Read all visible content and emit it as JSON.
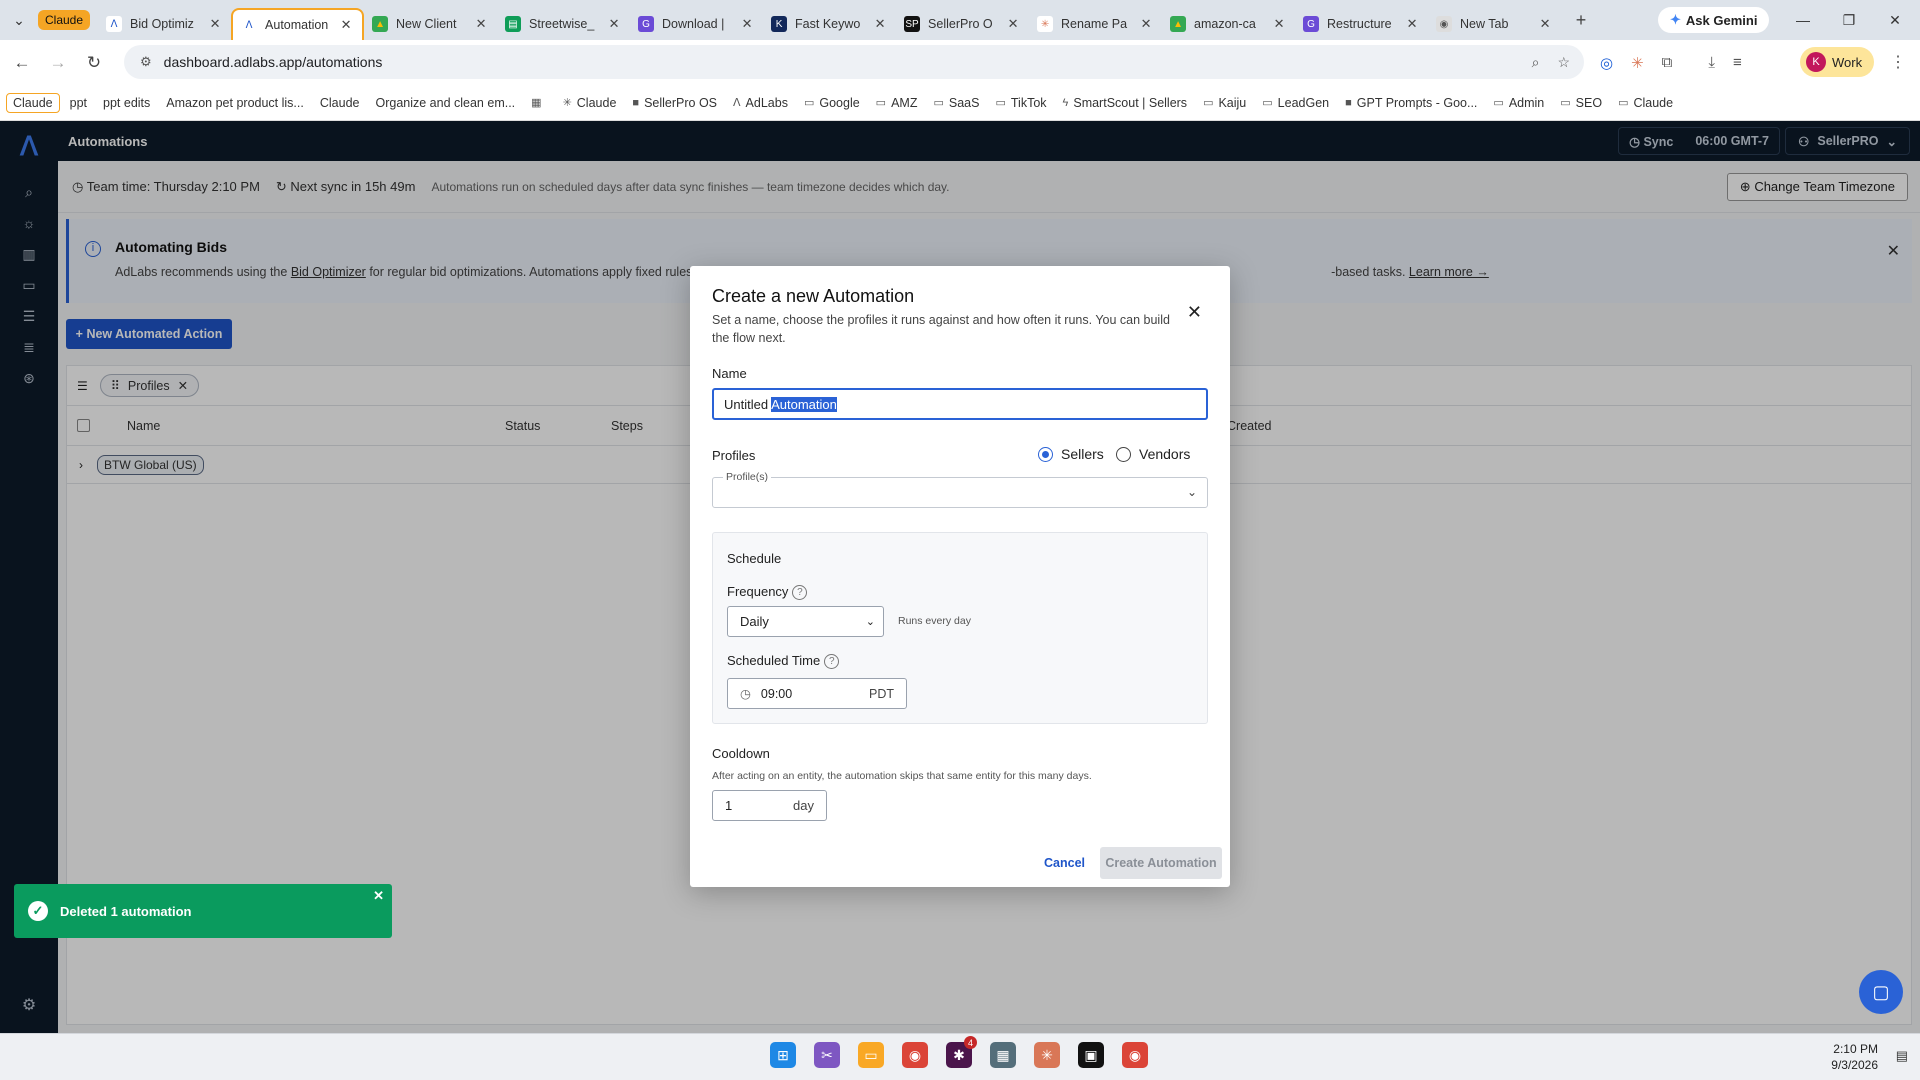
{
  "browser": {
    "tab_group": "Claude",
    "tabs": [
      {
        "title": "Bid Optimiz",
        "fav_color": "#ffffff",
        "fav_char": "ᐱ",
        "fav_fg": "#1f55c9"
      },
      {
        "title": "Automation",
        "fav_color": "#ffffff",
        "fav_char": "ᐱ",
        "fav_fg": "#1f55c9",
        "active": true
      },
      {
        "title": "New Client",
        "fav_color": "#34a853",
        "fav_char": "▲",
        "fav_fg": "#fbbc04"
      },
      {
        "title": "Streetwise_",
        "fav_color": "#0f9d58",
        "fav_char": "▤",
        "fav_fg": "#ffffff"
      },
      {
        "title": "Download |",
        "fav_color": "#6b4bd6",
        "fav_char": "G",
        "fav_fg": "#ffffff"
      },
      {
        "title": "Fast Keywo",
        "fav_color": "#12285a",
        "fav_char": "K",
        "fav_fg": "#ffffff"
      },
      {
        "title": "SellerPro O",
        "fav_color": "#111111",
        "fav_char": "SP",
        "fav_fg": "#ffffff"
      },
      {
        "title": "Rename Pa",
        "fav_color": "#ffffff",
        "fav_char": "✳",
        "fav_fg": "#d97757"
      },
      {
        "title": "amazon-ca",
        "fav_color": "#34a853",
        "fav_char": "▲",
        "fav_fg": "#fbbc04"
      },
      {
        "title": "Restructure",
        "fav_color": "#6b4bd6",
        "fav_char": "G",
        "fav_fg": "#ffffff"
      },
      {
        "title": "New Tab",
        "fav_color": "#dddddd",
        "fav_char": "◉",
        "fav_fg": "#555555"
      }
    ],
    "gemini_label": "Ask Gemini",
    "url": "dashboard.adlabs.app/automations",
    "profile_label": "Work",
    "profile_initial": "K",
    "bookmarks": [
      {
        "label": "Claude",
        "boxed": true
      },
      {
        "label": "ppt"
      },
      {
        "label": "ppt edits"
      },
      {
        "label": "Amazon pet product lis..."
      },
      {
        "label": "Claude"
      },
      {
        "label": "Organize and clean em..."
      },
      {
        "label": "",
        "icon": "▦"
      },
      {
        "label": "Claude",
        "icon": "✳"
      },
      {
        "label": "SellerPro OS",
        "icon": "■"
      },
      {
        "label": "AdLabs",
        "icon": "ᐱ"
      },
      {
        "label": "Google",
        "icon": "▭"
      },
      {
        "label": "AMZ",
        "icon": "▭"
      },
      {
        "label": "SaaS",
        "icon": "▭"
      },
      {
        "label": "TikTok",
        "icon": "▭"
      },
      {
        "label": "SmartScout | Sellers",
        "icon": "ϟ"
      },
      {
        "label": "Kaiju",
        "icon": "▭"
      },
      {
        "label": "LeadGen",
        "icon": "▭"
      },
      {
        "label": "GPT Prompts - Goo...",
        "icon": "■"
      },
      {
        "label": "Admin",
        "icon": "▭"
      },
      {
        "label": "SEO",
        "icon": "▭"
      },
      {
        "label": "Claude",
        "icon": "▭"
      }
    ]
  },
  "app": {
    "title": "Automations",
    "sync_label": "Sync",
    "sync_time": "06:00 GMT-7",
    "account": "SellerPRO",
    "team_time": "Team time: Thursday 2:10 PM",
    "next_sync": "Next sync in 15h 49m",
    "sync_note": "Automations run on scheduled days after data sync finishes — team timezone decides which day.",
    "change_tz": "Change Team Timezone",
    "banner_title": "Automating Bids",
    "banner_text_1": "AdLabs recommends using the",
    "banner_link": "Bid Optimizer",
    "banner_text_2": "for regular bid optimizations. Automations apply fixed rules with",
    "banner_text_3": "-based tasks.",
    "banner_learn": "Learn more →",
    "new_action": "+ New Automated Action",
    "filter_chip": "Profiles",
    "columns": [
      "Name",
      "Status",
      "Steps",
      "Created"
    ],
    "row_group": "BTW Global (US)"
  },
  "modal": {
    "title": "Create a new Automation",
    "subtitle": "Set a name, choose the profiles it runs against and how often it runs. You can build the flow next.",
    "name_label": "Name",
    "name_value_plain": "Untitled",
    "name_value_selected": "Automation",
    "profiles_label": "Profiles",
    "radio_sellers": "Sellers",
    "radio_vendors": "Vendors",
    "profiles_field_label": "Profile(s)",
    "schedule_label": "Schedule",
    "frequency_label": "Frequency",
    "frequency_value": "Daily",
    "frequency_hint": "Runs every day",
    "time_label": "Scheduled Time",
    "time_value": "09:00",
    "time_zone": "PDT",
    "cooldown_label": "Cooldown",
    "cooldown_hint": "After acting on an entity, the automation skips that same entity for this many days.",
    "cooldown_value": "1",
    "cooldown_unit": "day",
    "cancel": "Cancel",
    "create": "Create Automation"
  },
  "toast": {
    "message": "Deleted 1 automation"
  },
  "taskbar": {
    "time": "2:10 PM",
    "date": "9/3/2026",
    "slack_badge": "4"
  },
  "colors": {
    "accent": "#2a62d6",
    "nav_bg": "#0d1b2a",
    "toast_success": "#0a9b5e",
    "tab_group": "#f5a524"
  }
}
